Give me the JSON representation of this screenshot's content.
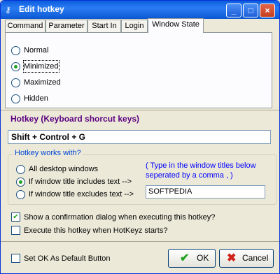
{
  "window": {
    "title": "Edit hotkey"
  },
  "tabs": [
    {
      "label": "Command"
    },
    {
      "label": "Parameter"
    },
    {
      "label": "Start In"
    },
    {
      "label": "Login"
    },
    {
      "label": "Window State"
    }
  ],
  "window_state": {
    "options": [
      {
        "label": "Normal"
      },
      {
        "label": "Minimized"
      },
      {
        "label": "Maximized"
      },
      {
        "label": "Hidden"
      }
    ],
    "selected": "Minimized"
  },
  "hotkey": {
    "title": "Hotkey (Keyboard shorcut keys)",
    "value": "Shift + Control + G"
  },
  "works_with": {
    "title": "Hotkey works with?",
    "options": [
      {
        "label": "All desktop windows"
      },
      {
        "label": "If window title includes text -->"
      },
      {
        "label": "If window title excludes text -->"
      }
    ],
    "selected": "If window title includes text -->",
    "hint": "( Type in the window titles below seperated by a comma , )",
    "titles_value": "SOFTPEDIA"
  },
  "options": {
    "confirm_label": "Show a confirmation dialog when executing this hotkey?",
    "confirm_checked": true,
    "on_start_label": "Execute this hotkey when HotKeyz starts?",
    "on_start_checked": false,
    "default_ok_label": "Set OK As Default Button",
    "default_ok_checked": false
  },
  "buttons": {
    "ok": "OK",
    "cancel": "Cancel"
  },
  "colors": {
    "titlebar": "#0a5ddd",
    "hotkey_title": "#5a0080",
    "group_title": "#0046d5",
    "hint": "#0000ff",
    "check_mark": "#21a121"
  }
}
